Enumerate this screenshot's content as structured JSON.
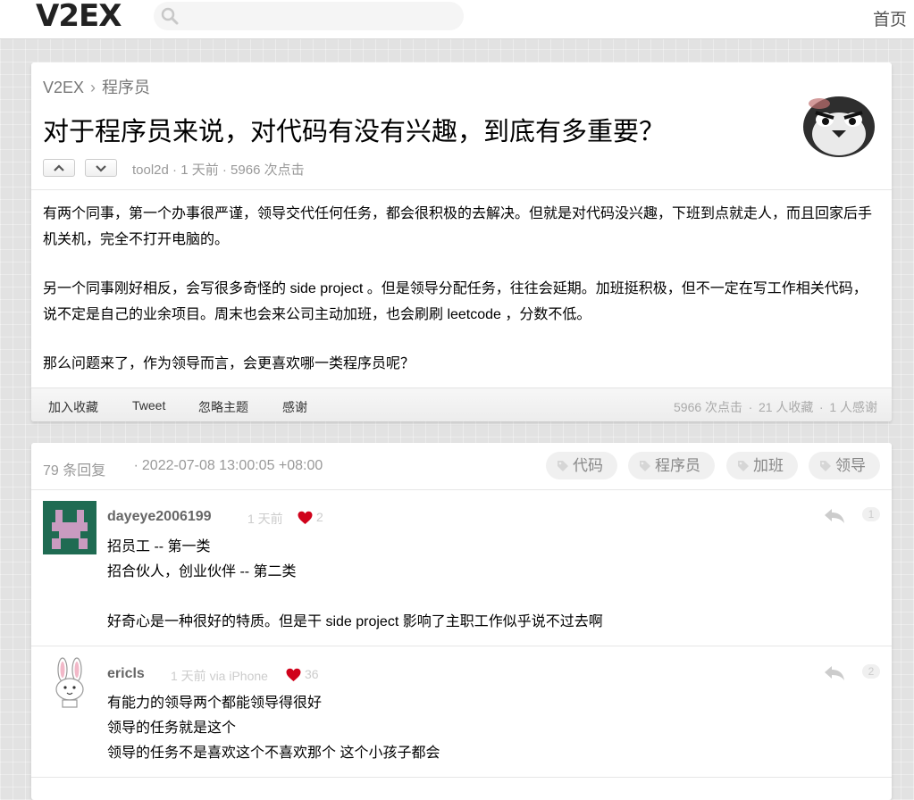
{
  "header": {
    "logo": "V2EX",
    "home_label": "首页"
  },
  "topic": {
    "breadcrumb": [
      "V2EX",
      "程序员"
    ],
    "breadcrumb_sep": "›",
    "title": "对于程序员来说，对代码有没有兴趣，到底有多重要？",
    "author": "tool2d",
    "meta_tail": " · 1 天前 · 5966 次点击",
    "content": [
      "有两个同事，第一个办事很严谨，领导交代任何任务，都会很积极的去解决。但就是对代码没兴趣，下班到点就走人，而且回家后手机关机，完全不打开电脑的。",
      "另一个同事刚好相反，会写很多奇怪的 side project 。但是领导分配任务，往往会延期。加班挺积极，但不一定在写工作相关代码，说不定是自己的业余项目。周末也会来公司主动加班，也会刷刷 leetcode ，分数不低。",
      "那么问题来了，作为领导而言，会更喜欢哪一类程序员呢？"
    ],
    "actions": [
      "加入收藏",
      "Tweet",
      "忽略主题",
      "感谢"
    ],
    "stats": [
      "5966 次点击",
      "21 人收藏",
      "1 人感谢"
    ],
    "stats_sep": "∙"
  },
  "replies": {
    "count": "79 条回复",
    "date": "∙ 2022-07-08 13:00:05 +08:00",
    "tags": [
      "代码",
      "程序员",
      "加班",
      "领导"
    ],
    "items": [
      {
        "user": "dayeye2006199",
        "time": "1 天前",
        "likes": "2",
        "floor": "1",
        "lines": [
          "招员工 -- 第一类",
          "招合伙人，创业伙伴 -- 第二类",
          "",
          "好奇心是一种很好的特质。但是干 side project 影响了主职工作似乎说不过去啊"
        ]
      },
      {
        "user": "ericls",
        "time": "1 天前 via iPhone",
        "likes": "36",
        "floor": "2",
        "lines": [
          "有能力的领导两个都能领导得很好",
          "领导的任务就是这个",
          "领导的任务不是喜欢这个不喜欢那个 这个小孩子都会"
        ]
      }
    ]
  },
  "colors": {
    "heart": "#d0021b",
    "avatar1_bg": "#1f6b52",
    "avatar1_fg": "#c99bc0",
    "muted": "#999999"
  }
}
